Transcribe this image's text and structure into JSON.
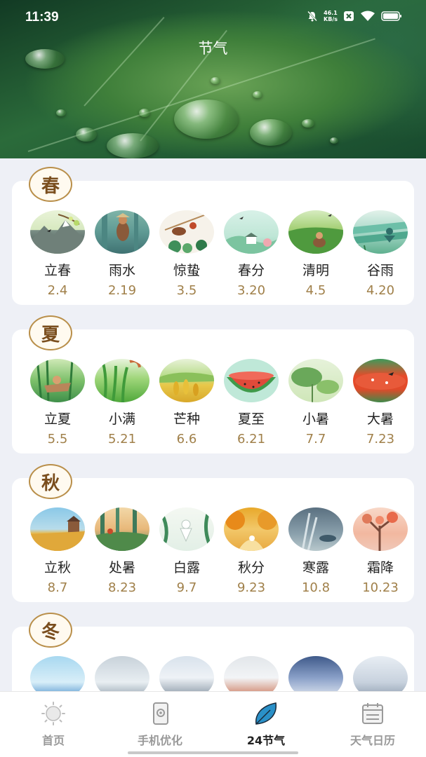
{
  "status_bar": {
    "time": "11:39",
    "net_speed_value": "46.1",
    "net_speed_unit": "KB/s"
  },
  "header": {
    "title": "节气"
  },
  "seasons": [
    {
      "label": "春",
      "terms": [
        {
          "name": "立春",
          "date": "2.4"
        },
        {
          "name": "雨水",
          "date": "2.19"
        },
        {
          "name": "惊蛰",
          "date": "3.5"
        },
        {
          "name": "春分",
          "date": "3.20"
        },
        {
          "name": "清明",
          "date": "4.5"
        },
        {
          "name": "谷雨",
          "date": "4.20"
        }
      ]
    },
    {
      "label": "夏",
      "terms": [
        {
          "name": "立夏",
          "date": "5.5"
        },
        {
          "name": "小满",
          "date": "5.21"
        },
        {
          "name": "芒种",
          "date": "6.6"
        },
        {
          "name": "夏至",
          "date": "6.21"
        },
        {
          "name": "小暑",
          "date": "7.7"
        },
        {
          "name": "大暑",
          "date": "7.23"
        }
      ]
    },
    {
      "label": "秋",
      "terms": [
        {
          "name": "立秋",
          "date": "8.7"
        },
        {
          "name": "处暑",
          "date": "8.23"
        },
        {
          "name": "白露",
          "date": "9.7"
        },
        {
          "name": "秋分",
          "date": "9.23"
        },
        {
          "name": "寒露",
          "date": "10.8"
        },
        {
          "name": "霜降",
          "date": "10.23"
        }
      ]
    },
    {
      "label": "冬"
    }
  ],
  "bottom_nav": [
    {
      "label": "首页",
      "icon": "sun-icon"
    },
    {
      "label": "手机优化",
      "icon": "phone-optimize-icon"
    },
    {
      "label": "24节气",
      "icon": "leaf-icon",
      "active": true
    },
    {
      "label": "天气日历",
      "icon": "calendar-icon"
    }
  ],
  "colors": {
    "accent_gold": "#a0804a",
    "badge_border": "#b98f4a",
    "badge_text": "#7a4e1e",
    "active_leaf": "#2a90c8"
  }
}
